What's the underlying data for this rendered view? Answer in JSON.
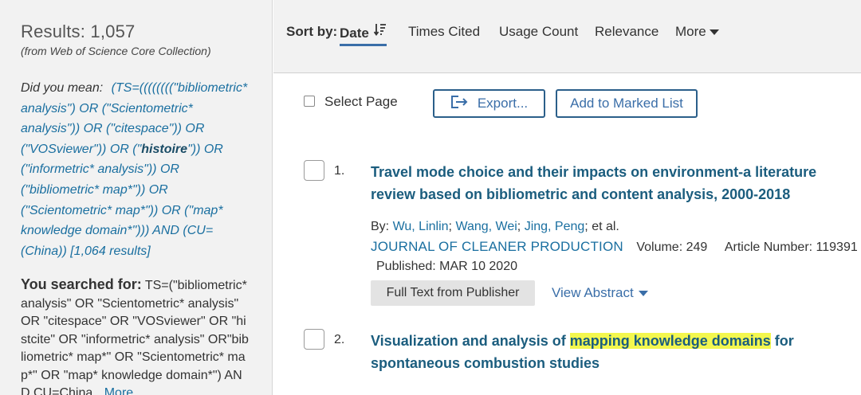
{
  "sidebar": {
    "results_count": "Results: 1,057",
    "results_source": "(from Web of Science Core Collection)",
    "did_you_mean_label": "Did you mean:",
    "did_you_mean_pre": "(TS=((((((((\"bibliometric* analysis\") OR (\"Scientometric* analysis\")) OR (\"citespace\")) OR (\"VOSviewer\")) OR (\"",
    "did_you_mean_bold": "histoire",
    "did_you_mean_post": "\")) OR (\"informetric* analysis\")) OR (\"bibliometric* map*\")) OR (\"Scientometric* map*\")) OR (\"map* knowledge domain*\"))) AND (CU=(China)) [1,064 results]",
    "you_searched_label": "You searched for:",
    "you_searched_query": "TS=(\"bibliometric* analysis\" OR \"Scientometric* analysis\" OR \"citespace\" OR \"VOSviewer\" OR \"histcite\" OR \"informetric* analysis\" OR\"bibliometric* map*\" OR \"Scientometric* map*\" OR \"map* knowledge domain*\") AND CU=China",
    "more_link": "More"
  },
  "sortbar": {
    "label": "Sort by:",
    "date": "Date",
    "times_cited": "Times Cited",
    "usage_count": "Usage Count",
    "relevance": "Relevance",
    "more": "More"
  },
  "actions": {
    "select_page": "Select Page",
    "export": "Export...",
    "add_to_marked": "Add to Marked List"
  },
  "records": [
    {
      "number": "1.",
      "title": "Travel mode choice and their impacts on environment-a literature review based on bibliometric and content analysis, 2000-2018",
      "by_label": "By:",
      "authors": [
        "Wu, Linlin",
        "Wang, Wei",
        "Jing, Peng"
      ],
      "et_al": "; et al.",
      "journal": "JOURNAL OF CLEANER PRODUCTION",
      "volume": "Volume: 249",
      "article_number": "Article Number: 119391",
      "published": "Published: MAR 10 2020",
      "full_text_button": "Full Text from Publisher",
      "view_abstract": "View Abstract"
    },
    {
      "number": "2.",
      "title_pre": "Visualization and analysis of ",
      "title_highlight": "mapping knowledge domains",
      "title_post": " for spontaneous combustion studies"
    }
  ],
  "colors": {
    "link_blue": "#1a6fa0",
    "title_blue": "#1b5d7e",
    "highlight_yellow": "#f3f74e",
    "panel_gray": "#f2f2f2",
    "button_border": "#2b5f8a"
  },
  "icons": {
    "sort_arrow": "sort-descending-icon",
    "export": "export-icon",
    "dropdown": "caret-down-icon"
  }
}
